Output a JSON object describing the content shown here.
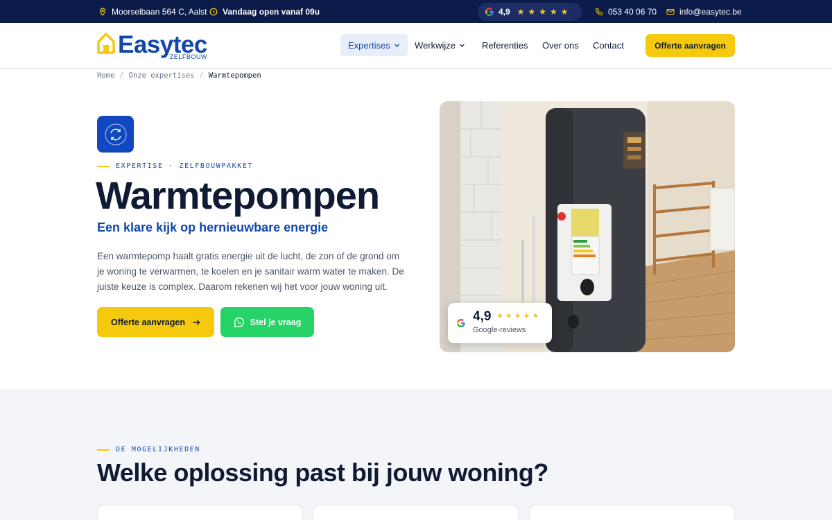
{
  "topbar": {
    "address": "Moorselbaan 564 C, Aalst",
    "opening": "Vandaag open vanaf 09u",
    "rating": "4,9",
    "stars": "★★★★★",
    "phone": "053 40 06 70",
    "email": "info@easytec.be"
  },
  "header": {
    "logo_word": "Easytec",
    "logo_sub": "ZELFBOUW",
    "nav": {
      "expertises": "Expertises",
      "werkwijze": "Werkwijze",
      "referenties": "Referenties",
      "over_ons": "Over ons",
      "contact": "Contact"
    },
    "cta": "Offerte aanvragen"
  },
  "breadcrumb": {
    "home": "Home",
    "expertises": "Onze expertises",
    "current": "Warmtepompen",
    "separator": "/"
  },
  "hero": {
    "eyebrow": "EXPERTISE · ZELFBOUWPAKKET",
    "title": "Warmtepompen",
    "subtitle": "Een klare kijk op hernieuwbare energie",
    "description": "Een warmtepomp haalt gratis energie uit de lucht, de zon of de grond om je woning te verwarmen, te koelen en je sanitair warm water te maken. De juiste keuze is complex. Daarom rekenen wij het voor jouw woning uit.",
    "btn_primary": "Offerte aanvragen",
    "btn_whatsapp": "Stel je vraag",
    "rating_card": {
      "value": "4,9",
      "stars": "★★★★★",
      "label": "Google-reviews"
    }
  },
  "section2": {
    "eyebrow": "DE MOGELIJKHEDEN",
    "title": "Welke oplossing past bij jouw woning?"
  },
  "colors": {
    "navy": "#0c1c4a",
    "brand_blue": "#1147a8",
    "yellow": "#f5c90d",
    "whatsapp_green": "#25d366"
  }
}
